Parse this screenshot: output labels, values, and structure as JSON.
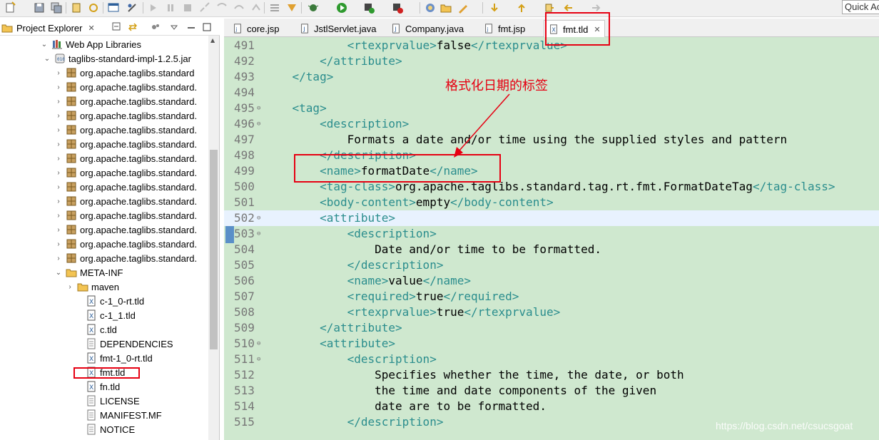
{
  "toolbar": {
    "quick_access": "Quick Ac"
  },
  "explorer": {
    "title": "Project Explorer",
    "tree": [
      {
        "label": "Web App Libraries",
        "icon": "library-icon",
        "expanded": true
      },
      {
        "label": "taglibs-standard-impl-1.2.5.jar",
        "icon": "jar-icon",
        "expanded": true
      },
      {
        "label": "org.apache.taglibs.standard",
        "icon": "package-icon",
        "expanded": false
      },
      {
        "label": "org.apache.taglibs.standard.",
        "icon": "package-icon",
        "expanded": false
      },
      {
        "label": "org.apache.taglibs.standard.",
        "icon": "package-icon",
        "expanded": false
      },
      {
        "label": "org.apache.taglibs.standard.",
        "icon": "package-icon",
        "expanded": false
      },
      {
        "label": "org.apache.taglibs.standard.",
        "icon": "package-icon",
        "expanded": false
      },
      {
        "label": "org.apache.taglibs.standard.",
        "icon": "package-icon",
        "expanded": false
      },
      {
        "label": "org.apache.taglibs.standard.",
        "icon": "package-icon",
        "expanded": false
      },
      {
        "label": "org.apache.taglibs.standard.",
        "icon": "package-icon",
        "expanded": false
      },
      {
        "label": "org.apache.taglibs.standard.",
        "icon": "package-icon",
        "expanded": false
      },
      {
        "label": "org.apache.taglibs.standard.",
        "icon": "package-icon",
        "expanded": false
      },
      {
        "label": "org.apache.taglibs.standard.",
        "icon": "package-icon",
        "expanded": false
      },
      {
        "label": "org.apache.taglibs.standard.",
        "icon": "package-icon",
        "expanded": false
      },
      {
        "label": "org.apache.taglibs.standard.",
        "icon": "package-icon",
        "expanded": false
      },
      {
        "label": "org.apache.taglibs.standard.",
        "icon": "package-icon",
        "expanded": false
      },
      {
        "label": "META-INF",
        "icon": "folder-icon",
        "expanded": true
      },
      {
        "label": "maven",
        "icon": "folder-icon",
        "expanded": false
      },
      {
        "label": "c-1_0-rt.tld",
        "icon": "xml-file-icon"
      },
      {
        "label": "c-1_1.tld",
        "icon": "xml-file-icon"
      },
      {
        "label": "c.tld",
        "icon": "xml-file-icon"
      },
      {
        "label": "DEPENDENCIES",
        "icon": "text-file-icon"
      },
      {
        "label": "fmt-1_0-rt.tld",
        "icon": "xml-file-icon"
      },
      {
        "label": "fmt.tld",
        "icon": "xml-file-icon"
      },
      {
        "label": "fn.tld",
        "icon": "xml-file-icon"
      },
      {
        "label": "LICENSE",
        "icon": "text-file-icon"
      },
      {
        "label": "MANIFEST.MF",
        "icon": "text-file-icon"
      },
      {
        "label": "NOTICE",
        "icon": "text-file-icon"
      }
    ]
  },
  "editor": {
    "tabs": [
      {
        "label": "core.jsp",
        "icon": "jsp-file-icon"
      },
      {
        "label": "JstlServlet.java",
        "icon": "java-file-icon"
      },
      {
        "label": "Company.java",
        "icon": "java-file-icon"
      },
      {
        "label": "fmt.jsp",
        "icon": "jsp-file-icon"
      },
      {
        "label": "fmt.tld",
        "icon": "xml-file-icon",
        "active": true
      }
    ],
    "lines": [
      {
        "num": "491",
        "indent": "            ",
        "parts": [
          [
            "t",
            "<rtexprvalue>"
          ],
          [
            "x",
            "false"
          ],
          [
            "t",
            "</rtexprvalue>"
          ]
        ]
      },
      {
        "num": "492",
        "indent": "        ",
        "parts": [
          [
            "t",
            "</attribute>"
          ]
        ]
      },
      {
        "num": "493",
        "indent": "    ",
        "parts": [
          [
            "t",
            "</tag>"
          ]
        ]
      },
      {
        "num": "494",
        "indent": "",
        "parts": []
      },
      {
        "num": "495",
        "fold": true,
        "indent": "    ",
        "parts": [
          [
            "t",
            "<tag>"
          ]
        ]
      },
      {
        "num": "496",
        "fold": true,
        "indent": "        ",
        "parts": [
          [
            "t",
            "<description>"
          ]
        ]
      },
      {
        "num": "497",
        "indent": "            ",
        "parts": [
          [
            "x",
            "Formats a date and/or time using the supplied styles and pattern"
          ]
        ]
      },
      {
        "num": "498",
        "indent": "        ",
        "parts": [
          [
            "t",
            "</description>"
          ]
        ]
      },
      {
        "num": "499",
        "indent": "        ",
        "parts": [
          [
            "t",
            "<name>"
          ],
          [
            "x",
            "formatDate"
          ],
          [
            "t",
            "</name>"
          ]
        ]
      },
      {
        "num": "500",
        "indent": "        ",
        "parts": [
          [
            "t",
            "<tag-class>"
          ],
          [
            "x",
            "org.apache.taglibs.standard.tag.rt.fmt.FormatDateTag"
          ],
          [
            "t",
            "</tag-class>"
          ]
        ]
      },
      {
        "num": "501",
        "indent": "        ",
        "parts": [
          [
            "t",
            "<body-content>"
          ],
          [
            "x",
            "empty"
          ],
          [
            "t",
            "</body-content>"
          ]
        ]
      },
      {
        "num": "502",
        "fold": true,
        "current": true,
        "indent": "        ",
        "parts": [
          [
            "t",
            "<attribute>"
          ]
        ]
      },
      {
        "num": "503",
        "fold": true,
        "indent": "            ",
        "parts": [
          [
            "t",
            "<description>"
          ]
        ]
      },
      {
        "num": "504",
        "indent": "                ",
        "parts": [
          [
            "x",
            "Date and/or time to be formatted."
          ]
        ]
      },
      {
        "num": "505",
        "indent": "            ",
        "parts": [
          [
            "t",
            "</description>"
          ]
        ]
      },
      {
        "num": "506",
        "indent": "            ",
        "parts": [
          [
            "t",
            "<name>"
          ],
          [
            "x",
            "value"
          ],
          [
            "t",
            "</name>"
          ]
        ]
      },
      {
        "num": "507",
        "indent": "            ",
        "parts": [
          [
            "t",
            "<required>"
          ],
          [
            "x",
            "true"
          ],
          [
            "t",
            "</required>"
          ]
        ]
      },
      {
        "num": "508",
        "indent": "            ",
        "parts": [
          [
            "t",
            "<rtexprvalue>"
          ],
          [
            "x",
            "true"
          ],
          [
            "t",
            "</rtexprvalue>"
          ]
        ]
      },
      {
        "num": "509",
        "indent": "        ",
        "parts": [
          [
            "t",
            "</attribute>"
          ]
        ]
      },
      {
        "num": "510",
        "fold": true,
        "indent": "        ",
        "parts": [
          [
            "t",
            "<attribute>"
          ]
        ]
      },
      {
        "num": "511",
        "fold": true,
        "indent": "            ",
        "parts": [
          [
            "t",
            "<description>"
          ]
        ]
      },
      {
        "num": "512",
        "indent": "                ",
        "parts": [
          [
            "x",
            "Specifies whether the time, the date, or both"
          ]
        ]
      },
      {
        "num": "513",
        "indent": "                ",
        "parts": [
          [
            "x",
            "the time and date components of the given"
          ]
        ]
      },
      {
        "num": "514",
        "indent": "                ",
        "parts": [
          [
            "x",
            "date are to be formatted."
          ]
        ]
      },
      {
        "num": "515",
        "indent": "            ",
        "parts": [
          [
            "t",
            "</description>"
          ]
        ]
      }
    ]
  },
  "annotation": {
    "text": "格式化日期的标签"
  },
  "watermark": "https://blog.csdn.net/csucsgoat",
  "colors": {
    "editor_bg": "#cfe8cf",
    "tag_color": "#2a8d8d",
    "highlight_red": "#e60012"
  }
}
